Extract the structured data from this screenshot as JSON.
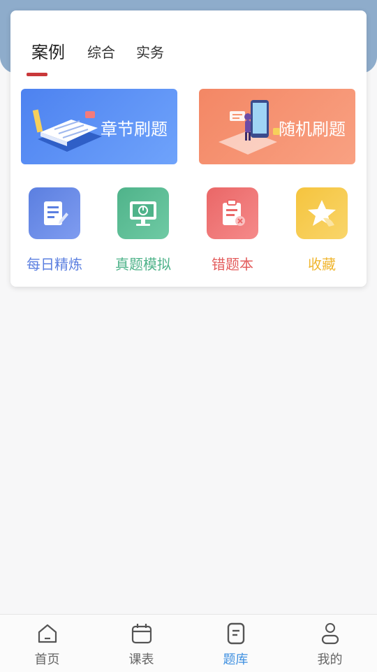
{
  "tabs": [
    {
      "label": "案例",
      "active": true
    },
    {
      "label": "综合",
      "active": false
    },
    {
      "label": "实务",
      "active": false
    }
  ],
  "banners": [
    {
      "label": "章节刷题",
      "color": "#5a8ef5",
      "icon": "book-icon"
    },
    {
      "label": "随机刷题",
      "color": "#f6946f",
      "icon": "phone-illustration-icon"
    }
  ],
  "quick_items": [
    {
      "label": "每日精炼",
      "color": "#5b7fe0",
      "icon": "edit-note-icon"
    },
    {
      "label": "真题模拟",
      "color": "#4fb38a",
      "icon": "monitor-icon"
    },
    {
      "label": "错题本",
      "color": "#e35d5d",
      "icon": "clipboard-error-icon"
    },
    {
      "label": "收藏",
      "color": "#f0b62f",
      "icon": "star-icon"
    }
  ],
  "bottom_nav": [
    {
      "label": "首页",
      "icon": "home-icon",
      "active": false
    },
    {
      "label": "课表",
      "icon": "calendar-icon",
      "active": false
    },
    {
      "label": "题库",
      "icon": "question-bank-icon",
      "active": true
    },
    {
      "label": "我的",
      "icon": "user-icon",
      "active": false
    }
  ],
  "accent_color": "#3d8fe0",
  "underline_color": "#c9383a"
}
